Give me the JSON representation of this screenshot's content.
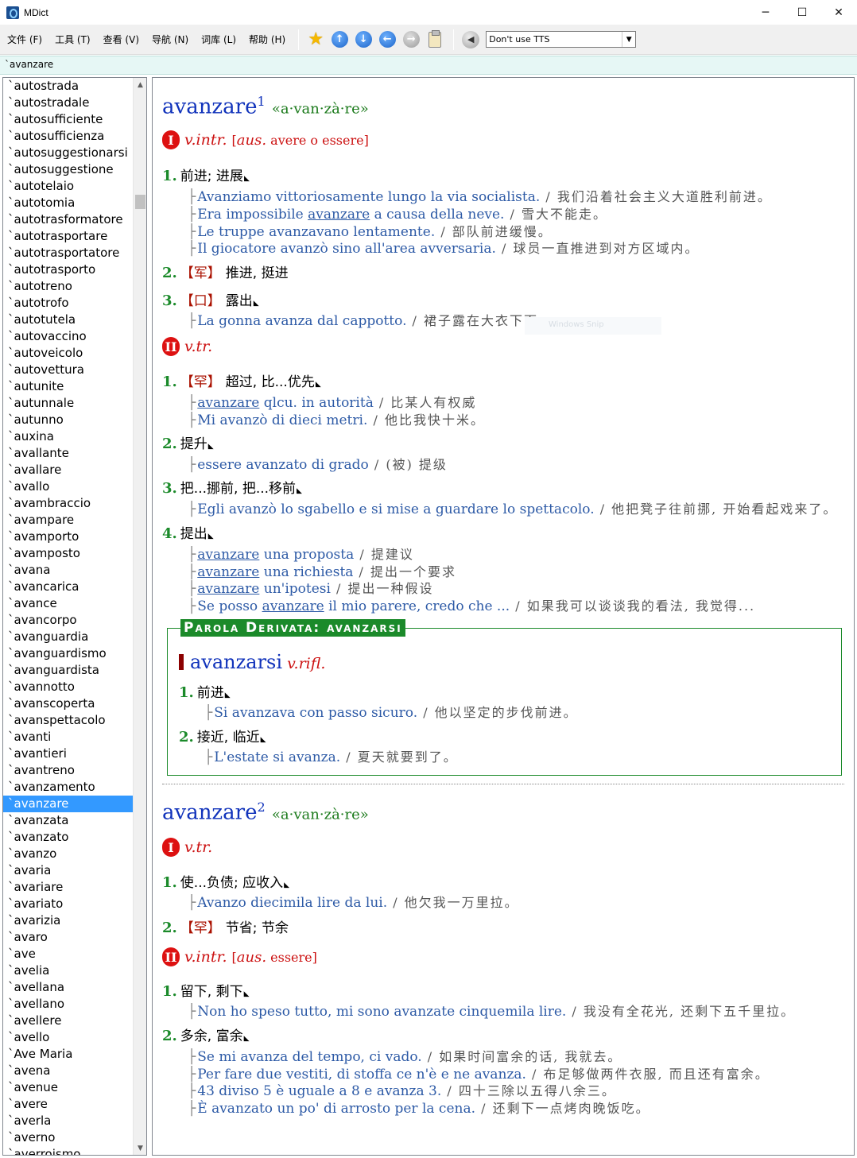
{
  "window": {
    "title": "MDict",
    "controls": [
      "─",
      "☐",
      "✕"
    ]
  },
  "menu": [
    {
      "label": "文件 (F)"
    },
    {
      "label": "工具 (T)"
    },
    {
      "label": "查看 (V)"
    },
    {
      "label": "导航 (N)"
    },
    {
      "label": "词库 (L)"
    },
    {
      "label": "帮助 (H)"
    }
  ],
  "toolbar": {
    "icons": [
      "star-icon",
      "arrow-up-icon",
      "arrow-down-icon",
      "arrow-left-icon",
      "arrow-right-icon",
      "clipboard-icon",
      "speaker-icon"
    ],
    "tts_value": "Don't use TTS"
  },
  "search": {
    "value": "`avanzare"
  },
  "wordlist": {
    "selected": "`avanzare",
    "items": [
      "`autostrada",
      "`autostradale",
      "`autosufficiente",
      "`autosufficienza",
      "`autosuggestionarsi",
      "`autosuggestione",
      "`autotelaio",
      "`autotomia",
      "`autotrasformatore",
      "`autotrasportare",
      "`autotrasportatore",
      "`autotrasporto",
      "`autotreno",
      "`autotrofo",
      "`autotutela",
      "`autovaccino",
      "`autoveicolo",
      "`autovettura",
      "`autunite",
      "`autunnale",
      "`autunno",
      "`auxina",
      "`avallante",
      "`avallare",
      "`avallo",
      "`avambraccio",
      "`avampare",
      "`avamporto",
      "`avamposto",
      "`avana",
      "`avancarica",
      "`avance",
      "`avancorpo",
      "`avanguardia",
      "`avanguardismo",
      "`avanguardista",
      "`avannotto",
      "`avanscoperta",
      "`avanspettacolo",
      "`avanti",
      "`avantieri",
      "`avantreno",
      "`avanzamento",
      "`avanzare",
      "`avanzata",
      "`avanzato",
      "`avanzo",
      "`avaria",
      "`avariare",
      "`avariato",
      "`avarizia",
      "`avaro",
      "`ave",
      "`avelia",
      "`avellana",
      "`avellano",
      "`avellere",
      "`avello",
      "`Ave Maria",
      "`avena",
      "`avenue",
      "`avere",
      "`averla",
      "`averno",
      "`averroismo"
    ]
  },
  "entry1": {
    "headword": "avanzare",
    "sup": "1",
    "pron": "«a·van·zà·re»",
    "section1": {
      "roman": "I",
      "pos": "v.intr.",
      "note_open": "[",
      "note_aus": "aus.",
      "note_text": " avere o essere]"
    },
    "s1": {
      "num": "1.",
      "def": "前进; 进展"
    },
    "s1_ex": [
      {
        "it": "Avanziamo vittoriosamente lungo la via socialista.",
        "zh": "我们沿着社会主义大道胜利前进。"
      },
      {
        "it_a": "Era impossibile ",
        "it_u": "avanzare",
        "it_b": " a causa della neve.",
        "zh": "雪大不能走。"
      },
      {
        "it": "Le truppe avanzavano lentamente.",
        "zh": "部队前进缓慢。"
      },
      {
        "it": "Il giocatore avanzò sino all'area avversaria.",
        "zh": "球员一直推进到对方区域内。"
      }
    ],
    "s2": {
      "num": "2.",
      "tag": "【军】",
      "def": "推进, 挺进"
    },
    "s3": {
      "num": "3.",
      "tag": "【口】",
      "def": "露出"
    },
    "s3_ex": [
      {
        "it": "La gonna avanza dal cappotto.",
        "zh": "裙子露在大衣下面。"
      }
    ],
    "section2": {
      "roman": "II",
      "pos": "v.tr."
    },
    "t1": {
      "num": "1.",
      "tag": "【罕】",
      "def": "超过, 比...优先"
    },
    "t1_ex": [
      {
        "it_u": "avanzare",
        "it_b": " qlcu. in autorità",
        "zh": "比某人有权威"
      },
      {
        "it": "Mi avanzò di dieci metri.",
        "zh": "他比我快十米。"
      }
    ],
    "t2": {
      "num": "2.",
      "def": "提升"
    },
    "t2_ex": [
      {
        "it": "essere avanzato di grado",
        "zh": "(被) 提级"
      }
    ],
    "t3": {
      "num": "3.",
      "def": "把...挪前, 把...移前"
    },
    "t3_ex": [
      {
        "it": "Egli avanzò lo sgabello e si mise a guardare lo spettacolo.",
        "zh": "他把凳子往前挪, 开始看起戏来了。"
      }
    ],
    "t4": {
      "num": "4.",
      "def": "提出"
    },
    "t4_ex": [
      {
        "it_u": "avanzare",
        "it_b": " una proposta",
        "zh": "提建议"
      },
      {
        "it_u": "avanzare",
        "it_b": " una richiesta",
        "zh": "提出一个要求"
      },
      {
        "it_u": "avanzare",
        "it_b": " un'ipotesi",
        "zh": "提出一种假设"
      },
      {
        "it_a": "Se posso ",
        "it_u": "avanzare",
        "it_b": " il mio parere, credo che ...",
        "zh": "如果我可以谈谈我的看法, 我觉得..."
      }
    ],
    "derived": {
      "title": "Parola Derivata: avanzarsi",
      "headword": "avanzarsi",
      "pos": "v.rifl.",
      "d1": {
        "num": "1.",
        "def": "前进"
      },
      "d1_ex": [
        {
          "it": "Si avanzava con passo sicuro.",
          "zh": "他以坚定的步伐前进。"
        }
      ],
      "d2": {
        "num": "2.",
        "def": "接近, 临近"
      },
      "d2_ex": [
        {
          "it": "L'estate si avanza.",
          "zh": "夏天就要到了。"
        }
      ]
    }
  },
  "entry2": {
    "headword": "avanzare",
    "sup": "2",
    "pron": "«a·van·zà·re»",
    "section1": {
      "roman": "I",
      "pos": "v.tr."
    },
    "s1": {
      "num": "1.",
      "def": "使...负债; 应收入"
    },
    "s1_ex": [
      {
        "it": "Avanzo diecimila lire da lui.",
        "zh": "他欠我一万里拉。"
      }
    ],
    "s2": {
      "num": "2.",
      "tag": "【罕】",
      "def": "节省; 节余"
    },
    "section2": {
      "roman": "II",
      "pos": "v.intr.",
      "note_open": "[",
      "note_aus": "aus.",
      "note_text": " essere]"
    },
    "t1": {
      "num": "1.",
      "def": "留下, 剩下"
    },
    "t1_ex": [
      {
        "it": "Non ho speso tutto, mi sono avanzate cinquemila lire.",
        "zh": "我没有全花光, 还剩下五千里拉。"
      }
    ],
    "t2": {
      "num": "2.",
      "def": "多余, 富余"
    },
    "t2_ex": [
      {
        "it": "Se mi avanza del tempo, ci vado.",
        "zh": "如果时间富余的话, 我就去。"
      },
      {
        "it": "Per fare due vestiti, di stoffa ce n'è e ne avanza.",
        "zh": "布足够做两件衣服, 而且还有富余。"
      },
      {
        "it": "43 diviso 5 è uguale a 8 e avanza 3.",
        "zh": "四十三除以五得八余三。"
      },
      {
        "it": "È avanzato un po' di arrosto per la cena.",
        "zh": "还剩下一点烤肉晚饭吃。"
      }
    ]
  },
  "ghost": "Windows Snip"
}
